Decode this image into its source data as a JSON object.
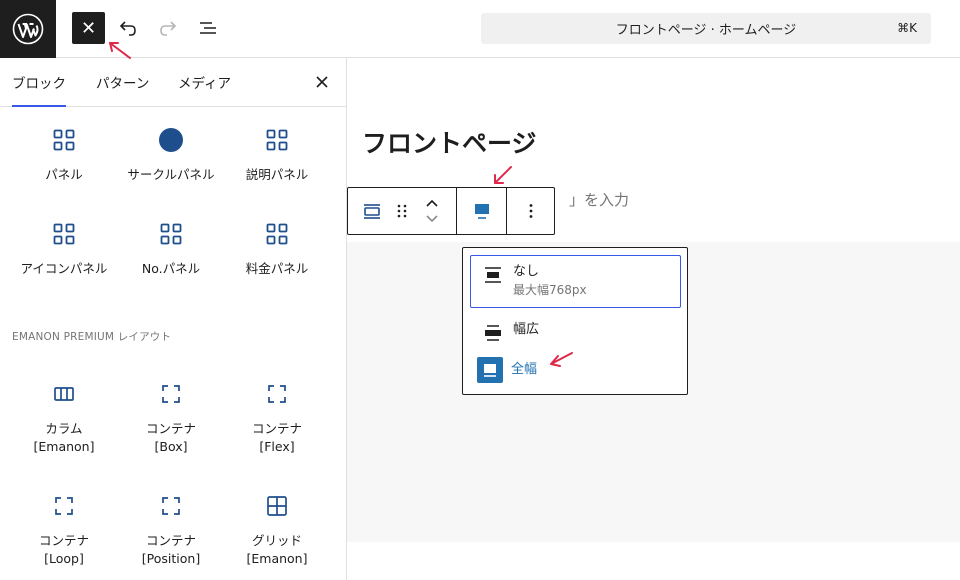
{
  "topbar": {
    "wp_logo_icon": "wordpress-logo",
    "close_label": "✕",
    "undo_icon": "undo-icon",
    "redo_icon": "redo-icon",
    "document_overview_icon": "list-view-icon",
    "command_bar_text": "フロントページ · ホームページ",
    "command_shortcut": "⌘K"
  },
  "inserter": {
    "tabs": [
      {
        "label": "ブロック",
        "active": true
      },
      {
        "label": "パターン",
        "active": false
      },
      {
        "label": "メディア",
        "active": false
      }
    ],
    "close_icon": "close-icon",
    "blocks_row1": [
      {
        "label": "パネル",
        "icon": "grid-icon"
      },
      {
        "label": "サークルパネル",
        "icon": "circle-icon"
      },
      {
        "label": "説明パネル",
        "icon": "grid-icon"
      }
    ],
    "blocks_row2": [
      {
        "label": "アイコンパネル",
        "icon": "grid-icon"
      },
      {
        "label": "No.パネル",
        "icon": "grid-icon"
      },
      {
        "label": "料金パネル",
        "icon": "grid-icon"
      }
    ],
    "category_title": "EMANON PREMIUM レイアウト",
    "blocks_row3": [
      {
        "label": "カラム",
        "sub": "[Emanon]",
        "icon": "columns-icon"
      },
      {
        "label": "コンテナ",
        "sub": "[Box]",
        "icon": "container-icon"
      },
      {
        "label": "コンテナ",
        "sub": "[Flex]",
        "icon": "container-icon"
      }
    ],
    "blocks_row4": [
      {
        "label": "コンテナ",
        "sub": "[Loop]",
        "icon": "container-icon"
      },
      {
        "label": "コンテナ",
        "sub": "[Position]",
        "icon": "container-icon"
      },
      {
        "label": "グリッド",
        "sub": "[Emanon]",
        "icon": "grid-layout-icon"
      }
    ]
  },
  "canvas": {
    "page_title": "フロントページ",
    "placeholder_tail": "」を入力"
  },
  "block_toolbar": {
    "block_type_icon": "group-block-icon",
    "drag_icon": "drag-handle-icon",
    "move_icon": "move-up-down-icon",
    "align_icon": "align-full-icon",
    "more_icon": "more-vertical-icon"
  },
  "align_dropdown": {
    "options": [
      {
        "label": "なし",
        "sub": "最大幅768px",
        "icon": "align-none-icon"
      },
      {
        "label": "幅広",
        "icon": "align-wide-icon"
      },
      {
        "label": "全幅",
        "icon": "align-full-icon"
      }
    ]
  },
  "colors": {
    "accent_blue": "#3858e9",
    "link_blue": "#2271b1",
    "annotation_red": "#e0284a",
    "icon_blue": "#1e4e8c"
  }
}
